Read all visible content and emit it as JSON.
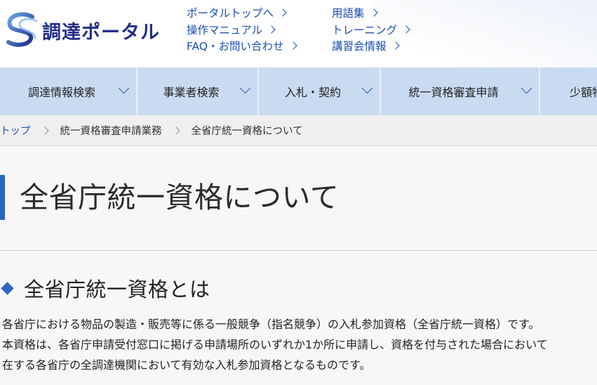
{
  "header": {
    "logo_text": "調達ポータル",
    "links_col1": [
      {
        "label": "ポータルトップへ"
      },
      {
        "label": "操作マニュアル"
      },
      {
        "label": "FAQ・お問い合わせ"
      }
    ],
    "links_col2": [
      {
        "label": "用語集"
      },
      {
        "label": "トレーニング"
      },
      {
        "label": "講習会情報"
      }
    ]
  },
  "nav": {
    "items": [
      {
        "label": "調達情報検索"
      },
      {
        "label": "事業者検索"
      },
      {
        "label": "入札・契約"
      },
      {
        "label": "統一資格審査申請"
      },
      {
        "label": "少額物"
      }
    ]
  },
  "breadcrumb": {
    "items": [
      {
        "label": "トップ"
      },
      {
        "label": "統一資格審査申請業務"
      },
      {
        "label": "全省庁統一資格について"
      }
    ]
  },
  "main": {
    "page_title": "全省庁統一資格について",
    "section_title": "全省庁統一資格とは",
    "paragraph_lines": [
      "各省庁における物品の製造・販売等に係る一般競争（指名競争）の入札参加資格（全省庁統一資格）です。",
      "本資格は、各省庁申請受付窓口に掲げる申請場所のいずれか1か所に申請し、資格を付与された場合において",
      "在する各省庁の全調達機関において有効な入札参加資格となるものです。"
    ]
  },
  "colors": {
    "brand_navy": "#232f8a",
    "link_blue": "#1a4fb3",
    "nav_bg": "#c9dbf0",
    "accent_blue": "#2a63c6"
  },
  "icons": {
    "logo": "s-swirl-logo-icon",
    "link_arrow": "chevron-right-icon",
    "nav_dropdown": "chevron-down-icon",
    "section_marker": "diamond-icon"
  }
}
